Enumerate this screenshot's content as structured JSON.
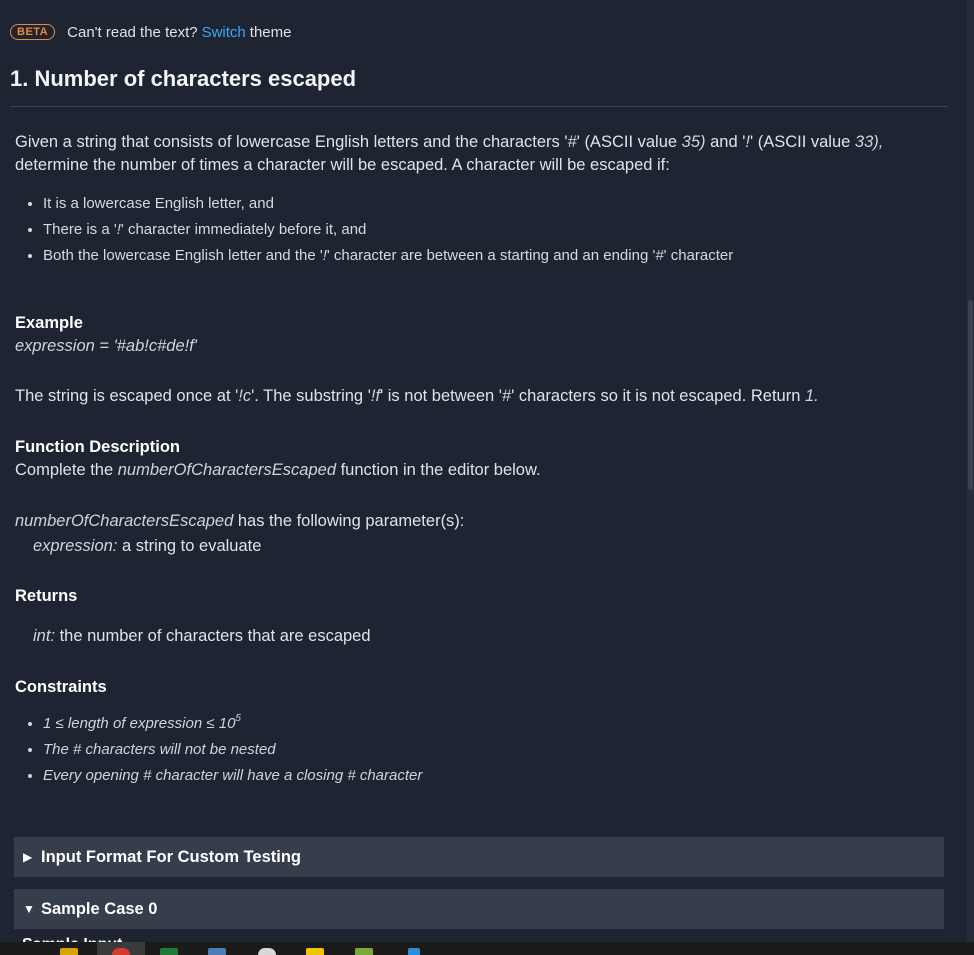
{
  "beta_bar": {
    "badge": "BETA",
    "prefix": "Can't read the text?",
    "link": "Switch",
    "suffix": "theme"
  },
  "title": "1. Number of characters escaped",
  "intro": {
    "t1": "Given a string that consists of lowercase English letters and the characters '",
    "hash": "#",
    "t2": "' (ASCII value ",
    "v35": "35)",
    "t3": " and '",
    "bang": "!",
    "t4": "' (ASCII value ",
    "v33": "33),",
    "t5": " determine the number of times a character will be escaped. A character will be escaped if:"
  },
  "rules": {
    "r1": "It is a lowercase English letter, and",
    "r2a": "There is a '",
    "r2b": "!",
    "r2c": "' character immediately before it, and",
    "r3a": "Both the lowercase English letter and the '",
    "r3b": "!",
    "r3c": "' character are between a starting and an ending '",
    "r3d": "#",
    "r3e": "' character"
  },
  "example": {
    "heading": "Example",
    "expr": "expression = '#ab!c#de!f'",
    "e1": "The string is escaped once at '",
    "e2": "!c",
    "e3": "'. The substring '",
    "e4": "!f",
    "e5": "' is not between '",
    "e6": "#",
    "e7": "' characters so it is not escaped. Return ",
    "e8": "1."
  },
  "function_description": {
    "heading": "Function Description",
    "d1": "Complete the ",
    "fname": "numberOfCharactersEscaped",
    "d2": " function in the editor below.",
    "p1": "numberOfCharactersEscaped",
    "p2": " has the following parameter(s):",
    "param_name": "expression:",
    "param_desc": " a string to evaluate"
  },
  "returns": {
    "heading": "Returns",
    "type": "int:",
    "desc": " the number of characters that are escaped"
  },
  "constraints": {
    "heading": "Constraints",
    "c1a": "1 ≤ length of expression ≤ 10",
    "c1sup": "5",
    "c2": "The # characters will not be nested",
    "c3": "Every opening # character will have a closing # character"
  },
  "accordions": {
    "input_format": "Input Format For Custom Testing",
    "sample_case": "Sample Case 0",
    "sample_input_peek": "Sample Input"
  },
  "colors": {
    "background": "#1e2431",
    "accent_link": "#39a9f5",
    "beta_badge": "#e9873a",
    "accordion_bg": "#363d4b"
  },
  "icons": {
    "collapsed": "triangle-right-icon",
    "expanded": "triangle-down-icon"
  }
}
